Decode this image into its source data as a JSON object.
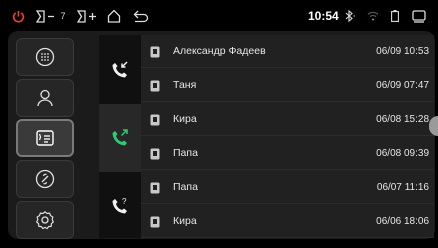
{
  "statusbar": {
    "icons": [
      "power-icon",
      "volume-down-icon",
      "volume-up-icon",
      "home-icon",
      "back-icon",
      "bluetooth-icon",
      "wifi-icon",
      "battery-icon",
      "window-icon"
    ],
    "volume_level": "7",
    "time": "10:54",
    "power_color": "#ff3b30"
  },
  "sidebar": {
    "items": [
      {
        "name": "dialpad",
        "icon": "dialpad-icon",
        "active": false
      },
      {
        "name": "contacts",
        "icon": "contact-icon",
        "active": false
      },
      {
        "name": "call-log",
        "icon": "call-log-icon",
        "active": true
      },
      {
        "name": "link",
        "icon": "link-icon",
        "active": false
      },
      {
        "name": "settings",
        "icon": "settings-icon",
        "active": false
      }
    ]
  },
  "call_types": [
    {
      "name": "incoming",
      "icon": "incoming-call-icon",
      "active": false
    },
    {
      "name": "outgoing",
      "icon": "outgoing-call-icon",
      "active": true,
      "color": "#2ecc71"
    },
    {
      "name": "missed",
      "icon": "missed-call-icon",
      "active": false
    }
  ],
  "calls": [
    {
      "name": "Александр Фадеев",
      "time": "06/09 10:53"
    },
    {
      "name": "Таня",
      "time": "06/09 07:47"
    },
    {
      "name": "Кира",
      "time": "06/08 15:28"
    },
    {
      "name": "Папа",
      "time": "06/08 09:39"
    },
    {
      "name": "Папа",
      "time": "06/07 11:16"
    },
    {
      "name": "Кира",
      "time": "06/06 18:06"
    }
  ]
}
